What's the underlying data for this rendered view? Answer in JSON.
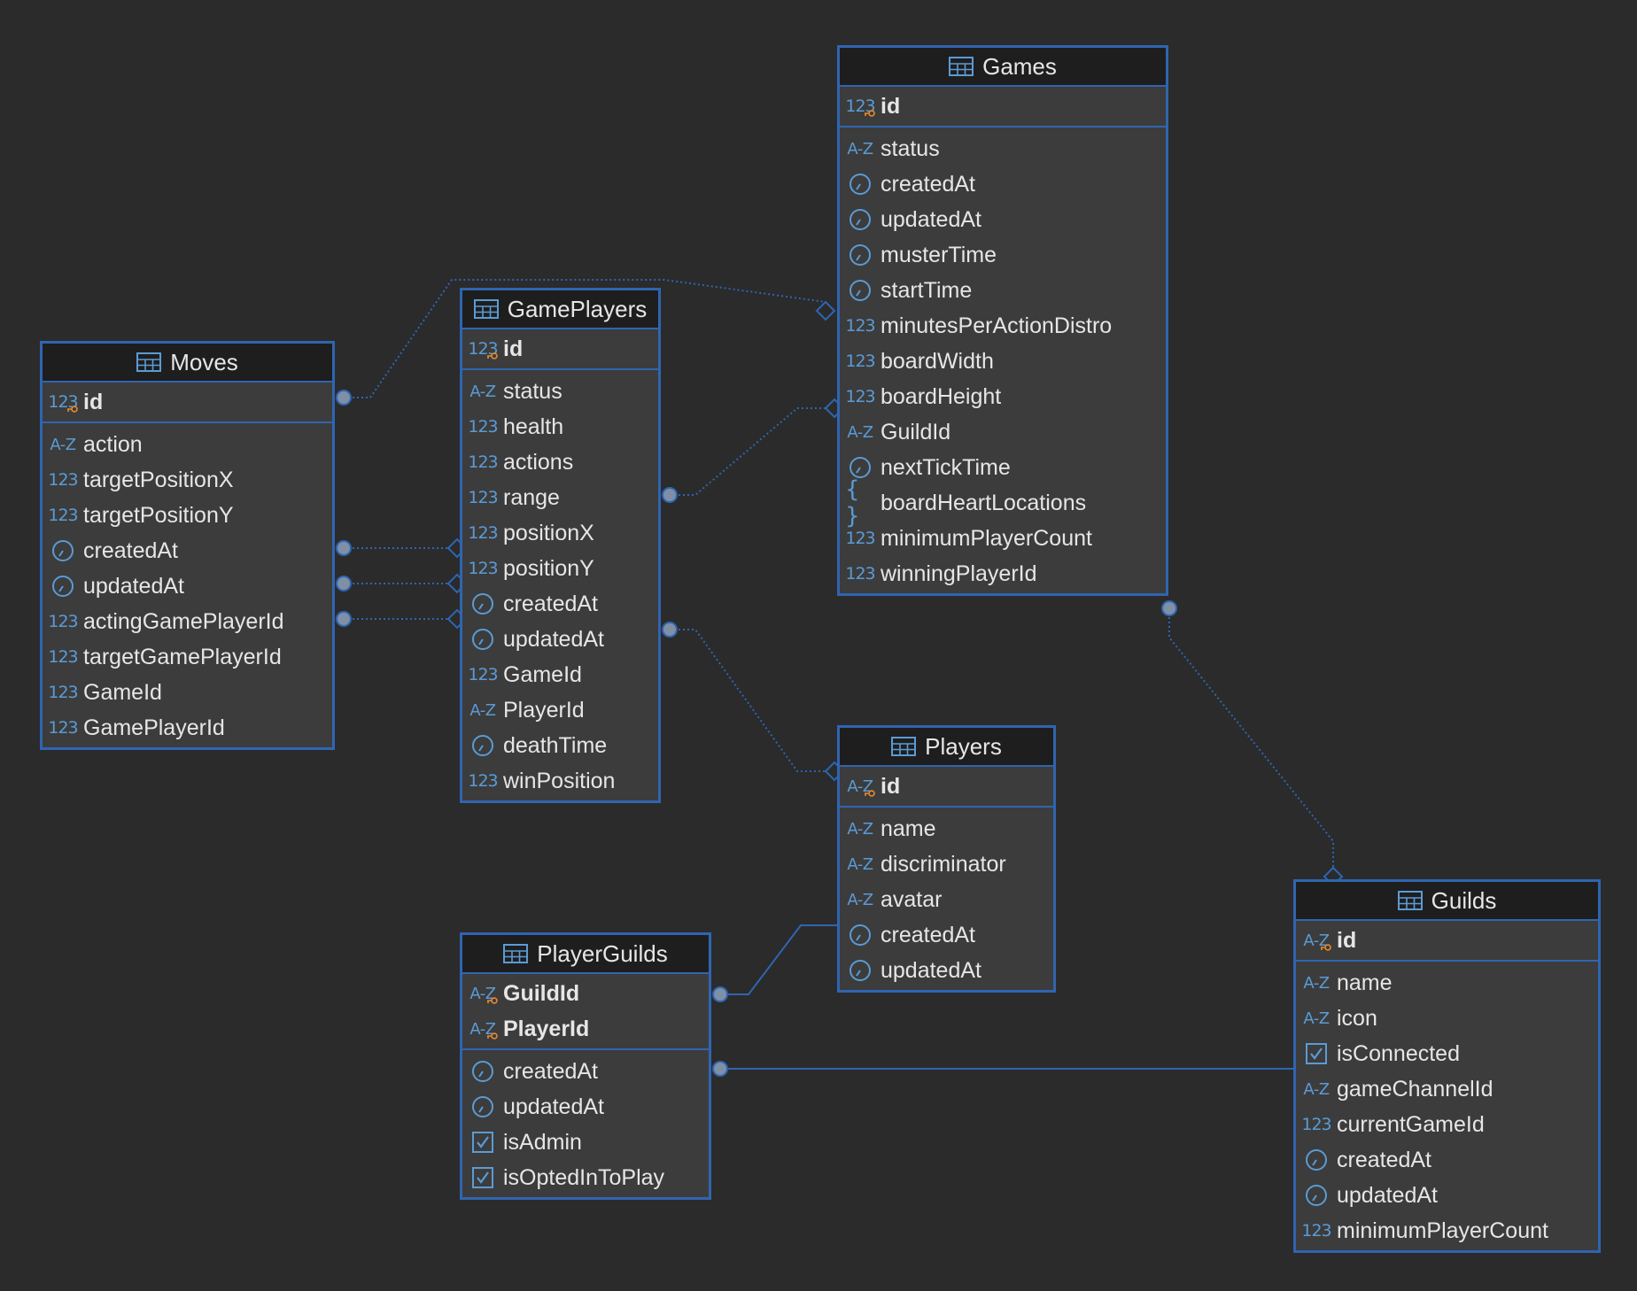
{
  "colors": {
    "background": "#2b2b2b",
    "accent": "#2f65b1",
    "type_icon": "#5b9bd5",
    "key_icon": "#e8892b"
  },
  "tables": [
    {
      "id": "moves",
      "name": "Moves",
      "pk": [
        {
          "name": "id",
          "type": "num"
        }
      ],
      "columns": [
        {
          "name": "action",
          "type": "text"
        },
        {
          "name": "targetPositionX",
          "type": "num"
        },
        {
          "name": "targetPositionY",
          "type": "num"
        },
        {
          "name": "createdAt",
          "type": "time"
        },
        {
          "name": "updatedAt",
          "type": "time"
        },
        {
          "name": "actingGamePlayerId",
          "type": "num"
        },
        {
          "name": "targetGamePlayerId",
          "type": "num"
        },
        {
          "name": "GameId",
          "type": "num"
        },
        {
          "name": "GamePlayerId",
          "type": "num"
        }
      ]
    },
    {
      "id": "gameplayers",
      "name": "GamePlayers",
      "pk": [
        {
          "name": "id",
          "type": "num"
        }
      ],
      "columns": [
        {
          "name": "status",
          "type": "text"
        },
        {
          "name": "health",
          "type": "num"
        },
        {
          "name": "actions",
          "type": "num"
        },
        {
          "name": "range",
          "type": "num"
        },
        {
          "name": "positionX",
          "type": "num"
        },
        {
          "name": "positionY",
          "type": "num"
        },
        {
          "name": "createdAt",
          "type": "time"
        },
        {
          "name": "updatedAt",
          "type": "time"
        },
        {
          "name": "GameId",
          "type": "num"
        },
        {
          "name": "PlayerId",
          "type": "text"
        },
        {
          "name": "deathTime",
          "type": "time"
        },
        {
          "name": "winPosition",
          "type": "num"
        }
      ]
    },
    {
      "id": "games",
      "name": "Games",
      "pk": [
        {
          "name": "id",
          "type": "num"
        }
      ],
      "columns": [
        {
          "name": "status",
          "type": "text"
        },
        {
          "name": "createdAt",
          "type": "time"
        },
        {
          "name": "updatedAt",
          "type": "time"
        },
        {
          "name": "musterTime",
          "type": "time"
        },
        {
          "name": "startTime",
          "type": "time"
        },
        {
          "name": "minutesPerActionDistro",
          "type": "num"
        },
        {
          "name": "boardWidth",
          "type": "num"
        },
        {
          "name": "boardHeight",
          "type": "num"
        },
        {
          "name": "GuildId",
          "type": "text"
        },
        {
          "name": "nextTickTime",
          "type": "time"
        },
        {
          "name": "boardHeartLocations",
          "type": "json"
        },
        {
          "name": "minimumPlayerCount",
          "type": "num"
        },
        {
          "name": "winningPlayerId",
          "type": "num"
        }
      ]
    },
    {
      "id": "players",
      "name": "Players",
      "pk": [
        {
          "name": "id",
          "type": "text"
        }
      ],
      "columns": [
        {
          "name": "name",
          "type": "text"
        },
        {
          "name": "discriminator",
          "type": "text"
        },
        {
          "name": "avatar",
          "type": "text"
        },
        {
          "name": "createdAt",
          "type": "time"
        },
        {
          "name": "updatedAt",
          "type": "time"
        }
      ]
    },
    {
      "id": "playerguilds",
      "name": "PlayerGuilds",
      "pk": [
        {
          "name": "GuildId",
          "type": "text"
        },
        {
          "name": "PlayerId",
          "type": "text"
        }
      ],
      "columns": [
        {
          "name": "createdAt",
          "type": "time"
        },
        {
          "name": "updatedAt",
          "type": "time"
        },
        {
          "name": "isAdmin",
          "type": "bool"
        },
        {
          "name": "isOptedInToPlay",
          "type": "bool"
        }
      ]
    },
    {
      "id": "guilds",
      "name": "Guilds",
      "pk": [
        {
          "name": "id",
          "type": "text"
        }
      ],
      "columns": [
        {
          "name": "name",
          "type": "text"
        },
        {
          "name": "icon",
          "type": "text"
        },
        {
          "name": "isConnected",
          "type": "bool"
        },
        {
          "name": "gameChannelId",
          "type": "text"
        },
        {
          "name": "currentGameId",
          "type": "num"
        },
        {
          "name": "createdAt",
          "type": "time"
        },
        {
          "name": "updatedAt",
          "type": "time"
        },
        {
          "name": "minimumPlayerCount",
          "type": "num"
        }
      ]
    }
  ],
  "relationships": [
    {
      "from": "moves.id",
      "to": "gameplayers.id",
      "style": "dotted"
    },
    {
      "from": "moves.createdAt",
      "to": "gameplayers.createdAt",
      "style": "dotted"
    },
    {
      "from": "moves.updatedAt",
      "to": "gameplayers.updatedAt",
      "style": "dotted"
    },
    {
      "from": "gameplayers.id",
      "to": "games.startTime",
      "style": "dotted"
    },
    {
      "from": "gameplayers.range",
      "to": "games.boardHeight",
      "style": "dotted"
    },
    {
      "from": "gameplayers.updatedAt",
      "to": "players.id",
      "style": "dotted"
    },
    {
      "from": "games.winningPlayerId",
      "to": "guilds.id",
      "style": "dotted"
    },
    {
      "from": "playerguilds.GuildId",
      "to": "players.createdAt",
      "style": "solid"
    },
    {
      "from": "playerguilds.createdAt",
      "to": "guilds.isConnected",
      "style": "solid"
    }
  ]
}
